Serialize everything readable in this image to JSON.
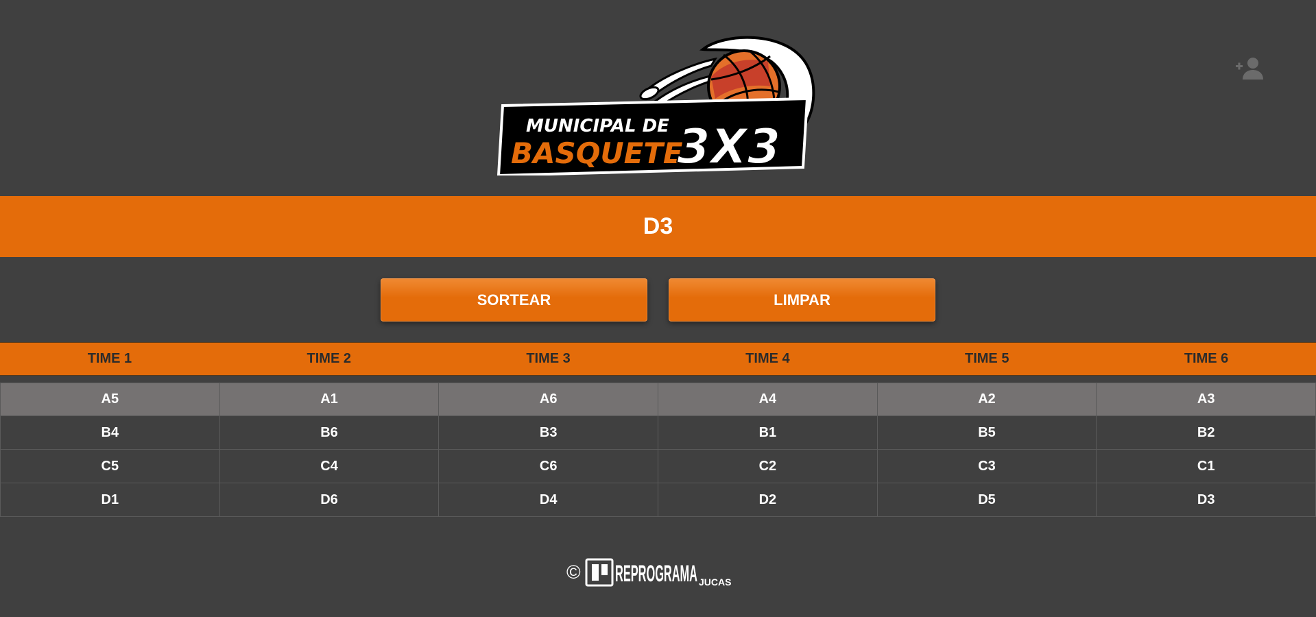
{
  "header": {
    "logo": {
      "line1": "MUNICIPAL DE",
      "line2": "BASQUETE",
      "badge": "3X3"
    },
    "add_user_icon": "person-add-icon"
  },
  "banner": {
    "title": "D3"
  },
  "actions": {
    "sortear_label": "SORTEAR",
    "limpar_label": "LIMPAR"
  },
  "table": {
    "headers": [
      "TIME 1",
      "TIME 2",
      "TIME 3",
      "TIME 4",
      "TIME 5",
      "TIME 6"
    ],
    "rows": [
      [
        "A5",
        "A1",
        "A6",
        "A4",
        "A2",
        "A3"
      ],
      [
        "B4",
        "B6",
        "B3",
        "B1",
        "B5",
        "B2"
      ],
      [
        "C5",
        "C4",
        "C6",
        "C2",
        "C3",
        "C1"
      ],
      [
        "D1",
        "D6",
        "D4",
        "D2",
        "D5",
        "D3"
      ]
    ]
  },
  "footer": {
    "copyright_symbol": "©",
    "brand_main": "REPROGRAMA",
    "brand_sub": "JUCAS"
  },
  "colors": {
    "background": "#404040",
    "accent": "#e46c0a",
    "highlight_row": "#757272"
  }
}
